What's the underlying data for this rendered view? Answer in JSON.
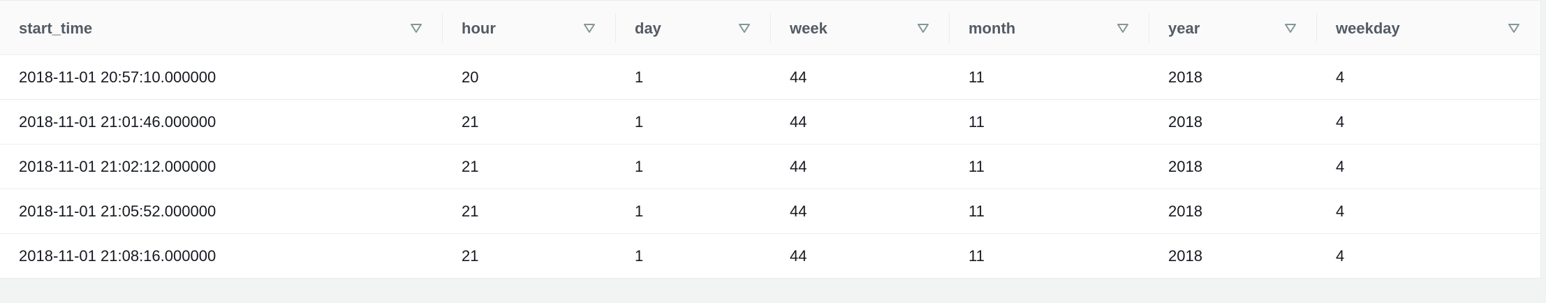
{
  "table": {
    "columns": [
      {
        "key": "start_time",
        "label": "start_time"
      },
      {
        "key": "hour",
        "label": "hour"
      },
      {
        "key": "day",
        "label": "day"
      },
      {
        "key": "week",
        "label": "week"
      },
      {
        "key": "month",
        "label": "month"
      },
      {
        "key": "year",
        "label": "year"
      },
      {
        "key": "weekday",
        "label": "weekday"
      }
    ],
    "sort_icon": "filter-triangle-icon",
    "rows": [
      [
        "2018-11-01 20:57:10.000000",
        "20",
        "1",
        "44",
        "11",
        "2018",
        "4"
      ],
      [
        "2018-11-01 21:01:46.000000",
        "21",
        "1",
        "44",
        "11",
        "2018",
        "4"
      ],
      [
        "2018-11-01 21:02:12.000000",
        "21",
        "1",
        "44",
        "11",
        "2018",
        "4"
      ],
      [
        "2018-11-01 21:05:52.000000",
        "21",
        "1",
        "44",
        "11",
        "2018",
        "4"
      ],
      [
        "2018-11-01 21:08:16.000000",
        "21",
        "1",
        "44",
        "11",
        "2018",
        "4"
      ]
    ]
  }
}
